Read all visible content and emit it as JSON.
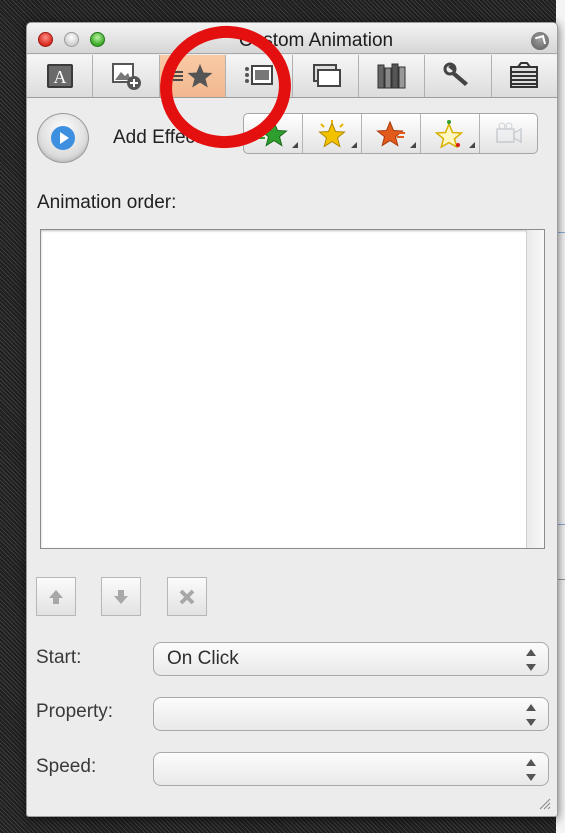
{
  "window": {
    "title": "Custom Animation"
  },
  "tabs": [
    {
      "icon": "text-formatting-icon",
      "active": false
    },
    {
      "icon": "insert-picture-icon",
      "active": false
    },
    {
      "icon": "custom-animation-star-icon",
      "active": true
    },
    {
      "icon": "transitions-icon",
      "active": false
    },
    {
      "icon": "slides-icon",
      "active": false
    },
    {
      "icon": "scrapbook-books-icon",
      "active": false
    },
    {
      "icon": "tools-wrench-icon",
      "active": false
    },
    {
      "icon": "slide-transition-icon",
      "active": false
    }
  ],
  "toolbar": {
    "add_effect_label": "Add Effect:",
    "effects": [
      {
        "icon": "entrance-effect-icon",
        "color": "#2e9e2e",
        "enabled": true
      },
      {
        "icon": "emphasis-effect-icon",
        "color": "#e8b400",
        "enabled": true
      },
      {
        "icon": "exit-effect-icon",
        "color": "#e25a1c",
        "enabled": true
      },
      {
        "icon": "motion-path-icon",
        "color": "#f0c800",
        "enabled": true
      },
      {
        "icon": "media-effect-icon",
        "color": "#9aa4ae",
        "enabled": false
      }
    ]
  },
  "order": {
    "label": "Animation order:",
    "items": []
  },
  "order_controls": [
    {
      "icon": "move-up-arrow-icon"
    },
    {
      "icon": "move-down-arrow-icon"
    },
    {
      "icon": "delete-x-icon"
    }
  ],
  "fields": {
    "start": {
      "label": "Start:",
      "value": "On Click"
    },
    "property": {
      "label": "Property:",
      "value": ""
    },
    "speed": {
      "label": "Speed:",
      "value": ""
    }
  },
  "annotation": {
    "color": "#e40f0f"
  }
}
